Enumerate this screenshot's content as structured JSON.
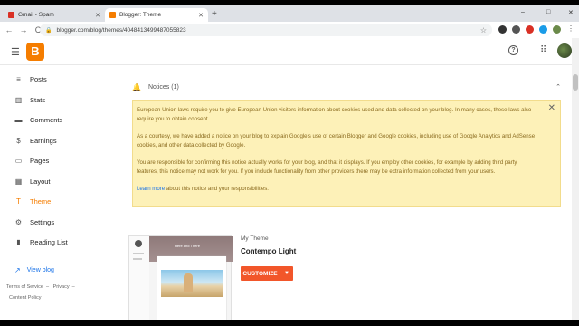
{
  "browser": {
    "tabs": [
      {
        "title": "Gmail - Spam",
        "active": false,
        "favicon_color": "#d93025"
      },
      {
        "title": "Blogger: Theme",
        "active": true,
        "favicon_color": "#f57d00"
      }
    ],
    "new_tab": "+",
    "window_controls": [
      "–",
      "□",
      "✕"
    ],
    "url": "blogger.com/blog/themes/4048413499487055823",
    "back": "←",
    "forward": "→",
    "reload": "C"
  },
  "app": {
    "logo_letter": "B",
    "help": "?",
    "apps": "⠿"
  },
  "sidebar": {
    "items": [
      {
        "label": "Posts",
        "icon": "≡"
      },
      {
        "label": "Stats",
        "icon": "▥"
      },
      {
        "label": "Comments",
        "icon": "▬"
      },
      {
        "label": "Earnings",
        "icon": "$"
      },
      {
        "label": "Pages",
        "icon": "▭"
      },
      {
        "label": "Layout",
        "icon": "▦"
      },
      {
        "label": "Theme",
        "icon": "T"
      },
      {
        "label": "Settings",
        "icon": "⚙"
      },
      {
        "label": "Reading List",
        "icon": "▮"
      }
    ],
    "active_index": 6,
    "view_blog": "View blog",
    "footer": {
      "terms": "Terms of Service",
      "privacy": "Privacy",
      "content_policy": "Content Policy",
      "sep": "–"
    }
  },
  "main": {
    "notices_title": "Notices (1)",
    "notice": {
      "p1": "European Union laws require you to give European Union visitors information about cookies used and data collected on your blog. In many cases, these laws also require you to obtain consent.",
      "p2": "As a courtesy, we have added a notice on your blog to explain Google's use of certain Blogger and Google cookies, including use of Google Analytics and AdSense cookies, and other data collected by Google.",
      "p3": "You are responsible for confirming this notice actually works for your blog, and that it displays. If you employ other cookies, for example by adding third party features, this notice may not work for you. If you include functionality from other providers there may be extra information collected from your users.",
      "learn_more": "Learn more",
      "p4_rest": " about this notice and your responsibilities."
    },
    "theme": {
      "section": "My Theme",
      "name": "Contempo Light",
      "customize": "CUSTOMIZE",
      "preview_title": "Here and There"
    }
  }
}
